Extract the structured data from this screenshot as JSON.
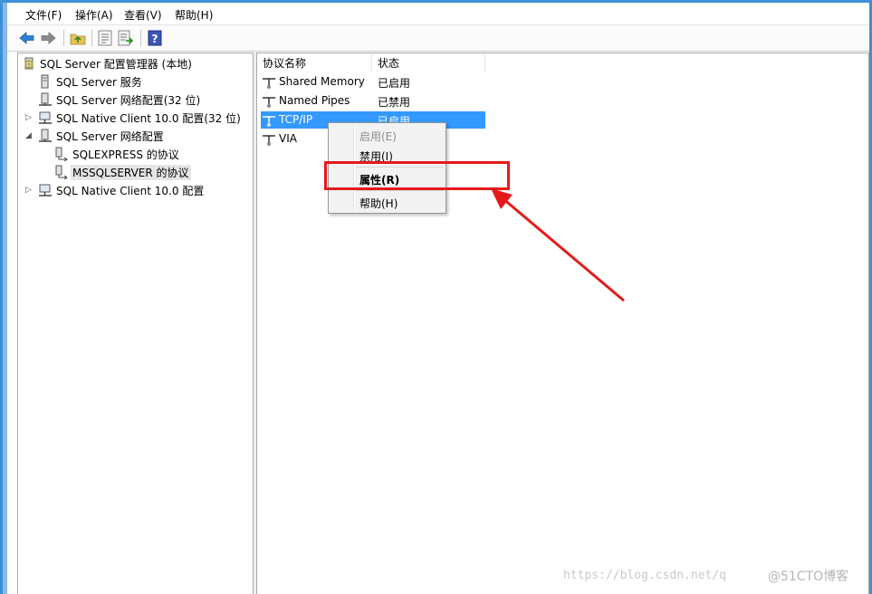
{
  "menubar": {
    "file": "文件(F)",
    "action": "操作(A)",
    "view": "查看(V)",
    "help": "帮助(H)"
  },
  "toolbar": {
    "buttons": [
      "back-arrow-icon",
      "forward-arrow-icon",
      "up-folder-icon",
      "properties-sheet-icon",
      "export-list-icon",
      "help-icon"
    ]
  },
  "tree": {
    "root": "SQL Server 配置管理器 (本地)",
    "items": [
      "SQL Server 服务",
      "SQL Server 网络配置(32 位)",
      "SQL Native Client 10.0 配置(32 位)",
      "SQL Server 网络配置",
      "SQLEXPRESS 的协议",
      "MSSQLSERVER 的协议",
      "SQL Native Client 10.0 配置"
    ]
  },
  "list": {
    "columns": [
      "协议名称",
      "状态"
    ],
    "rows": [
      {
        "name": "Shared Memory",
        "status": "已启用"
      },
      {
        "name": "Named Pipes",
        "status": "已禁用"
      },
      {
        "name": "TCP/IP",
        "status": "已启用"
      },
      {
        "name": "VIA",
        "status": ""
      }
    ]
  },
  "context_menu": {
    "items": [
      "启用(E)",
      "禁用(I)",
      "属性(R)",
      "帮助(H)"
    ]
  },
  "watermark": "https://blog.csdn.net/q",
  "watermark2": "@51CTO博客",
  "colors": {
    "selection": "#3399ff",
    "annotation_red": "#e41a1a",
    "window_frame": "#3d90d9"
  }
}
